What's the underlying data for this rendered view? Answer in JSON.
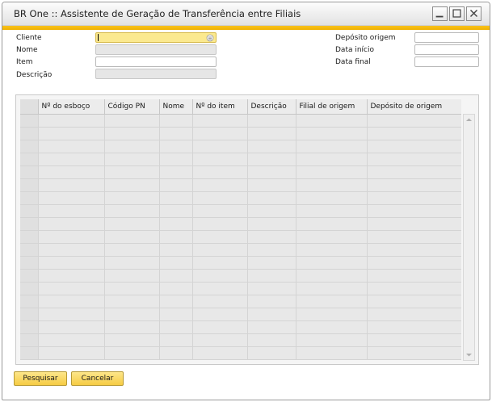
{
  "window": {
    "title": "BR One :: Assistente de Geração de Transferência entre Filiais"
  },
  "form": {
    "left": {
      "cliente_label": "Cliente",
      "nome_label": "Nome",
      "item_label": "Item",
      "descricao_label": "Descrição",
      "cliente_value": "",
      "nome_value": "",
      "item_value": "",
      "descricao_value": ""
    },
    "right": {
      "deposito_origem_label": "Depósito origem",
      "data_inicio_label": "Data início",
      "data_final_label": "Data final",
      "deposito_origem_value": "",
      "data_inicio_value": "",
      "data_final_value": ""
    }
  },
  "grid": {
    "columns": [
      "",
      "Nº do esboço",
      "Código PN",
      "Nome",
      "Nº do item",
      "Descrição",
      "Filial de origem",
      "Depósito de origem"
    ],
    "empty_rows": 19
  },
  "buttons": {
    "pesquisar": "Pesquisar",
    "cancelar": "Cancelar"
  },
  "colors": {
    "accent": "#f8c21c",
    "focus_field": "#fbe98f",
    "button": "#f6cc44"
  }
}
